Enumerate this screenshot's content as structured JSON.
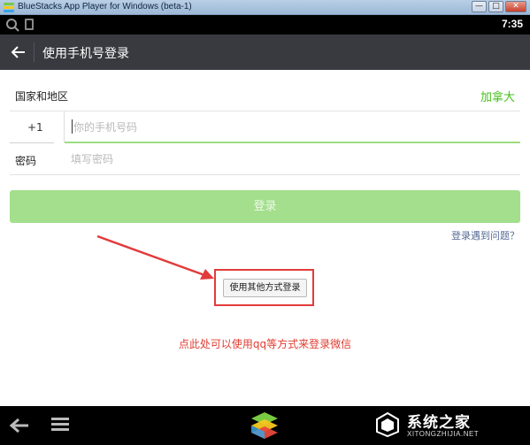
{
  "window": {
    "title": "BlueStacks App Player for Windows (beta-1)",
    "minimize_label": "—",
    "restore_label": "□",
    "close_label": "✕"
  },
  "statusbar": {
    "time": "7:35",
    "icons": [
      "search-icon",
      "sd-card-icon"
    ]
  },
  "appbar": {
    "title": "使用手机号登录",
    "back_icon": "back-arrow-icon"
  },
  "form": {
    "country_label": "国家和地区",
    "country_value": "加拿大",
    "phone_code": "+1",
    "phone_placeholder": "你的手机号码",
    "phone_value": "",
    "password_label": "密码",
    "password_placeholder": "填写密码",
    "password_value": "",
    "login_button": "登录",
    "problem_link": "登录遇到问题？",
    "other_method_button": "使用其他方式登录"
  },
  "annotation": {
    "text": "点此处可以使用qq等方式来登录微信",
    "color": "#e03c31"
  },
  "navbar": {
    "icons": [
      "back-icon",
      "menu-icon",
      "bluestacks-logo-icon"
    ]
  },
  "watermark": {
    "text": "系统之家",
    "url": "XITONGZHIJIA.NET"
  },
  "colors": {
    "accent_green": "#45c01a",
    "login_disabled_green": "#a3df8d",
    "appbar_bg": "#393a3f",
    "link_blue": "#576b95"
  }
}
